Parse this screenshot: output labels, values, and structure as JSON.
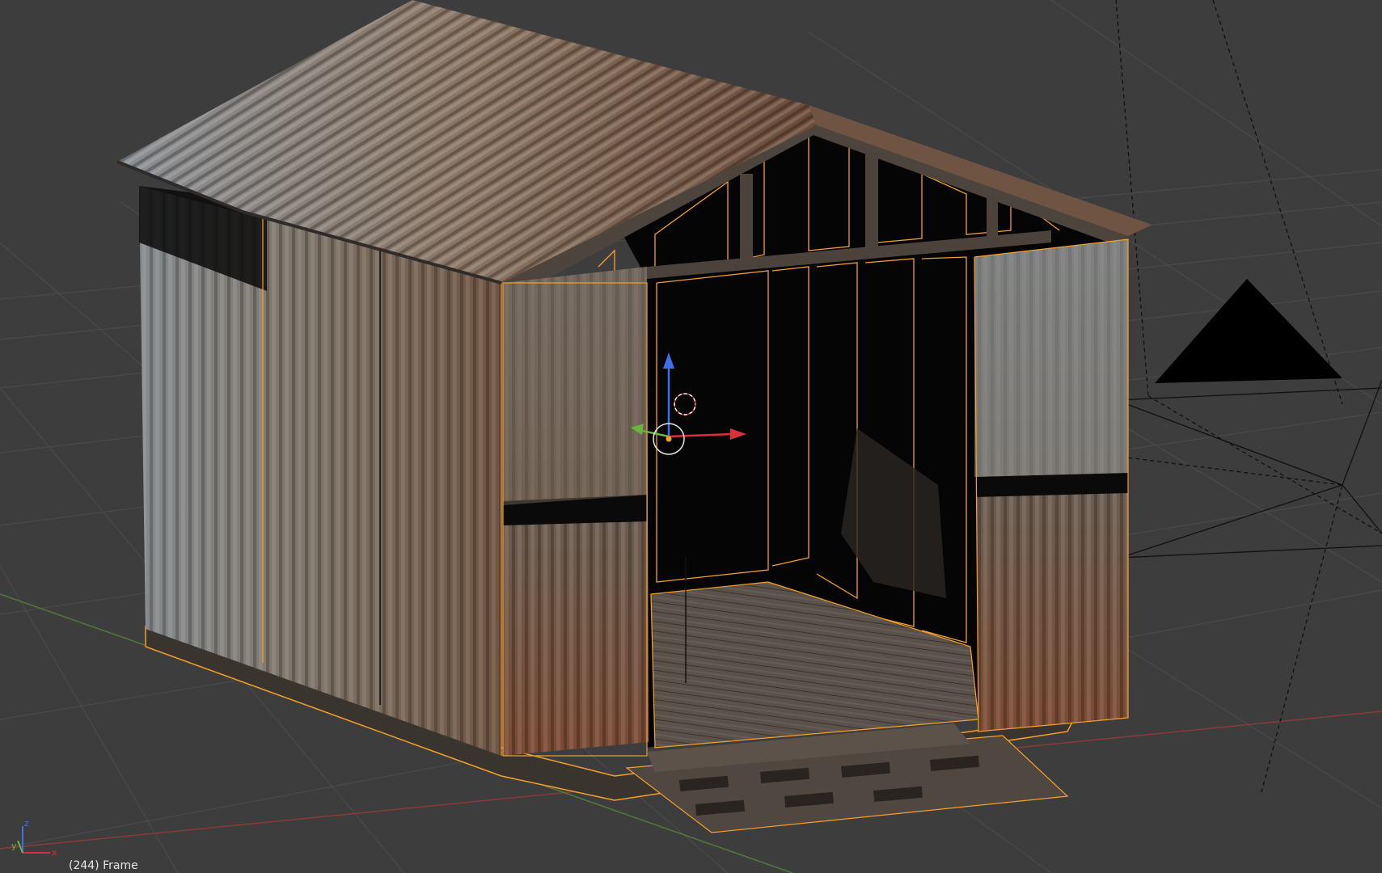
{
  "viewport": {
    "frame_label": "(244) Frame",
    "background_color": "#3d3d3d",
    "selection_outline_color": "#f5a02a",
    "axis_colors": {
      "x": "#d9303a",
      "y": "#6cb33f",
      "z": "#3e6ee8"
    }
  },
  "scene": {
    "object": "corrugated-metal-shed",
    "selected": true,
    "gizmo": "transform-manipulator",
    "camera": "camera-wireframe",
    "lamp": "lamp-gizmo"
  },
  "axis_indicator": {
    "x_label": "x",
    "y_label": "y",
    "z_label": "z"
  }
}
